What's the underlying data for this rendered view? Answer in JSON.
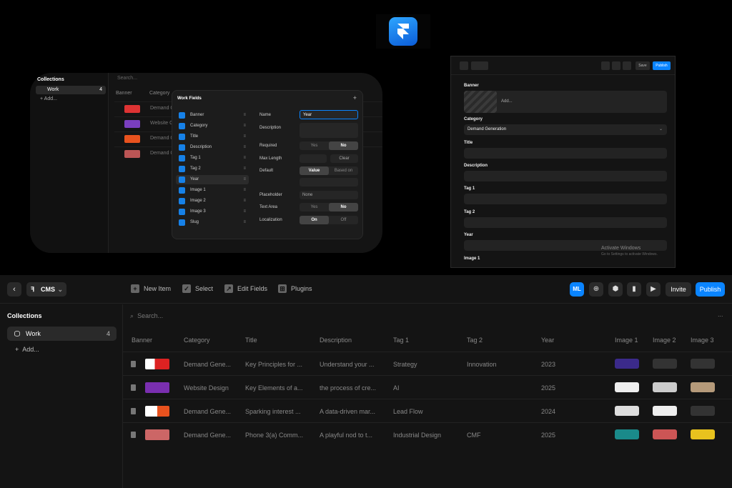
{
  "colors": {
    "accent": "#0a84ff",
    "bg": "#141414",
    "panel": "#2a2a2a"
  },
  "preview_left": {
    "collections_title": "Collections",
    "work_label": "Work",
    "work_count": "4",
    "add_label": "Add...",
    "search_placeholder": "Search...",
    "headers": [
      "Banner",
      "Category"
    ],
    "rows": [
      "Demand Ge",
      "Website Ge",
      "Demand Ge",
      "Demand Ge"
    ],
    "row_suffix": "1",
    "dialog": {
      "title": "Work Fields",
      "fields": [
        "Banner",
        "Category",
        "Title",
        "Description",
        "Tag 1",
        "Tag 2",
        "Year",
        "Image 1",
        "Image 2",
        "Image 3",
        "Slug"
      ],
      "labels": {
        "name": "Name",
        "description": "Description",
        "required": "Required",
        "max_length": "Max Length",
        "default": "Default",
        "placeholder": "Placeholder",
        "text_area": "Text Area",
        "localization": "Localization"
      },
      "name_value": "Year",
      "yes": "Yes",
      "no": "No",
      "clear": "Clear",
      "value": "Value",
      "based_on": "Based on",
      "none": "None",
      "on": "On",
      "off": "Off"
    }
  },
  "preview_right": {
    "save": "Save",
    "publish": "Publish",
    "banner_label": "Banner",
    "banner_add": "Add...",
    "category_label": "Category",
    "category_value": "Demand Generation",
    "labels": [
      "Title",
      "Description",
      "Tag 1",
      "Tag 2",
      "Year",
      "Image 1"
    ],
    "watermark": "Activate Windows",
    "watermark_sub": "Go to Settings to activate Windows."
  },
  "cms": {
    "cms_label": "CMS",
    "toolbar": {
      "new_item": "New Item",
      "select": "Select",
      "edit_fields": "Edit Fields",
      "plugins": "Plugins"
    },
    "ml_label": "ML",
    "invite": "Invite",
    "publish": "Publish",
    "collections_title": "Collections",
    "work_label": "Work",
    "work_count": "4",
    "add_label": "Add...",
    "search_placeholder": "Search...",
    "more": "...",
    "columns": [
      "Banner",
      "Category",
      "Title",
      "Description",
      "Tag 1",
      "Tag 2",
      "Year",
      "Image 1",
      "Image 2",
      "Image 3"
    ],
    "rows": [
      {
        "category": "Demand Gene...",
        "title": "Key Principles for ...",
        "description": "Understand your ...",
        "tag1": "Strategy",
        "tag2": "Innovation",
        "year": "2023"
      },
      {
        "category": "Website Design",
        "title": "Key Elements of a...",
        "description": "the process of cre...",
        "tag1": "AI",
        "tag2": "",
        "year": "2025"
      },
      {
        "category": "Demand Gene...",
        "title": "Sparking interest ...",
        "description": "A data-driven mar...",
        "tag1": "Lead Flow",
        "tag2": "",
        "year": "2024"
      },
      {
        "category": "Demand Gene...",
        "title": "Phone 3(a) Comm...",
        "description": "A playful nod to t...",
        "tag1": "Industrial Design",
        "tag2": "CMF",
        "year": "2025"
      }
    ]
  }
}
